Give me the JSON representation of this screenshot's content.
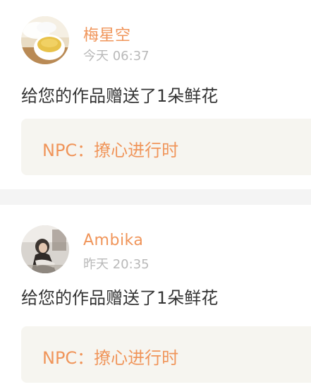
{
  "notifications": [
    {
      "user_name": "梅星空",
      "time": "今天 06:37",
      "message": "给您的作品赠送了1朵鲜花",
      "work_title": "NPC：撩心进行时"
    },
    {
      "user_name": "Ambika",
      "time": "昨天 20:35",
      "message": "给您的作品赠送了1朵鲜花",
      "work_title": "NPC：撩心进行时"
    }
  ],
  "colors": {
    "accent": "#f0955a",
    "time_gray": "#b9b9b9",
    "message_text": "#333333",
    "work_box_bg": "#f6f5f0",
    "divider_bg": "#f4f4f4"
  },
  "icons": {
    "avatar_1": "tea-cup-avatar",
    "avatar_2": "person-photo-avatar"
  }
}
